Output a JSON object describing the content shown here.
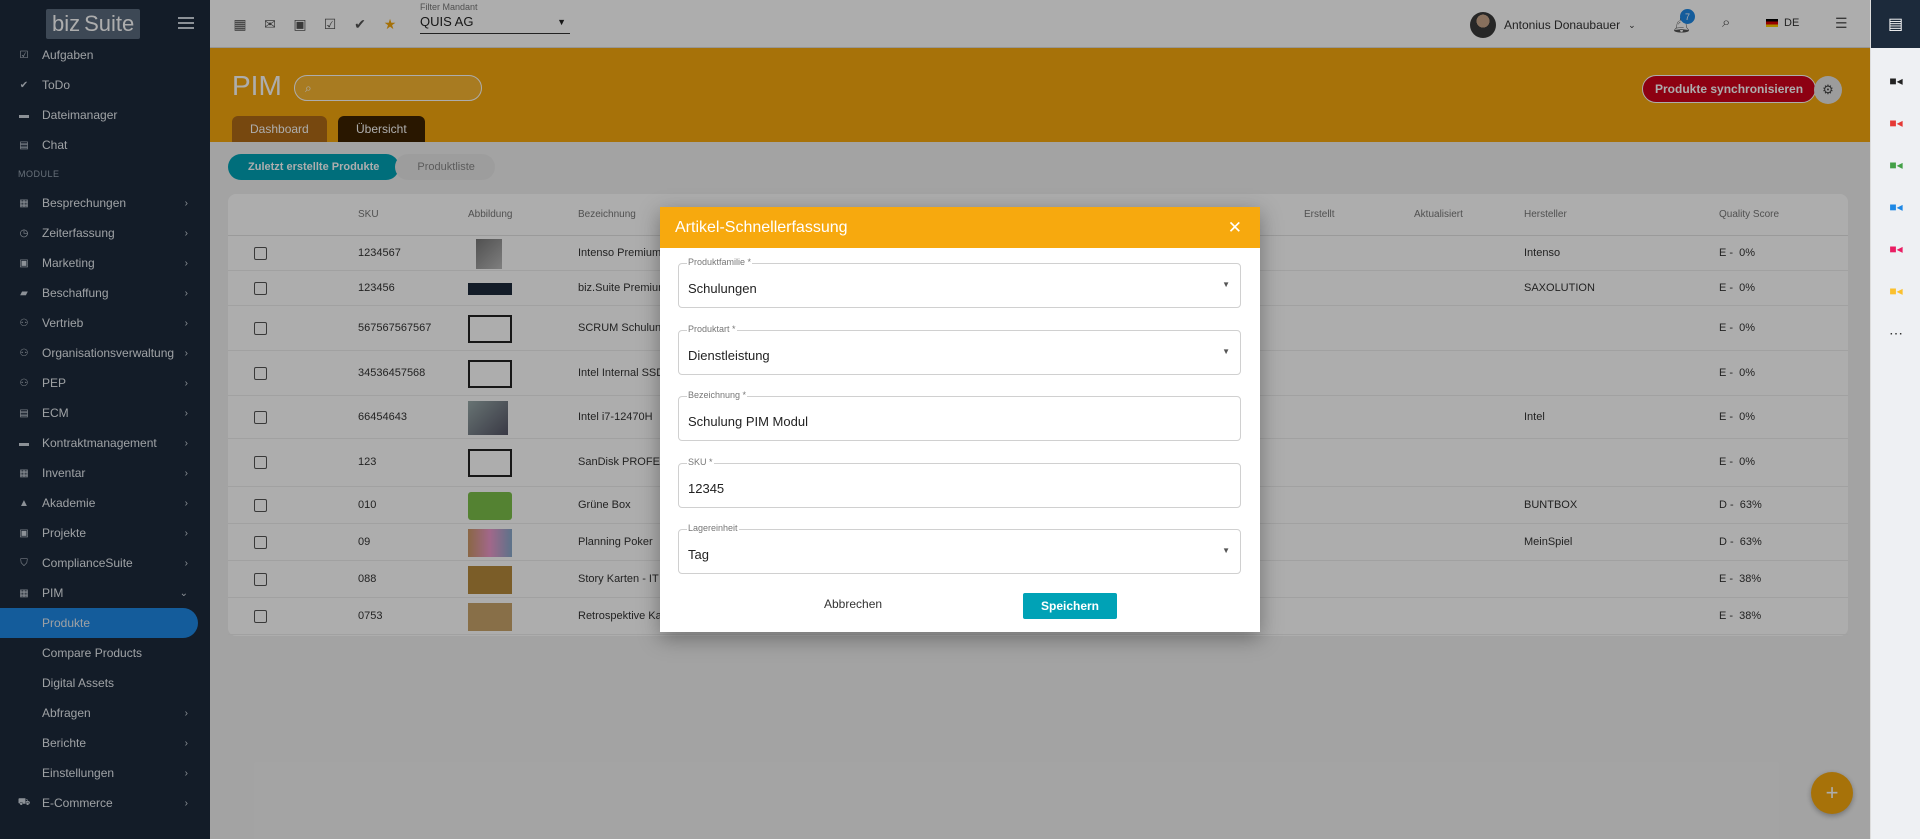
{
  "app": {
    "logo_biz": "biz",
    "logo_suite": "Suite"
  },
  "sidebar": {
    "top_items": [
      {
        "label": "Aufgaben",
        "icon": "task-icon"
      },
      {
        "label": "ToDo",
        "icon": "check-icon"
      },
      {
        "label": "Dateimanager",
        "icon": "folder-icon"
      },
      {
        "label": "Chat",
        "icon": "chat-icon"
      }
    ],
    "section_label": "MODULE",
    "modules": [
      {
        "label": "Besprechungen",
        "icon": "meeting-icon"
      },
      {
        "label": "Zeiterfassung",
        "icon": "clock-icon"
      },
      {
        "label": "Marketing",
        "icon": "marketing-icon"
      },
      {
        "label": "Beschaffung",
        "icon": "truck-icon"
      },
      {
        "label": "Vertrieb",
        "icon": "people-icon"
      },
      {
        "label": "Organisationsverwaltung",
        "icon": "org-icon"
      },
      {
        "label": "PEP",
        "icon": "people-icon"
      },
      {
        "label": "ECM",
        "icon": "document-icon"
      },
      {
        "label": "Kontraktmanagement",
        "icon": "briefcase-icon"
      },
      {
        "label": "Inventar",
        "icon": "inventory-icon"
      },
      {
        "label": "Akademie",
        "icon": "school-icon"
      },
      {
        "label": "Projekte",
        "icon": "project-icon"
      },
      {
        "label": "ComplianceSuite",
        "icon": "shield-icon"
      },
      {
        "label": "PIM",
        "icon": "pim-icon"
      }
    ],
    "pim_sub": [
      {
        "label": "Produkte",
        "active": true,
        "has_children": false
      },
      {
        "label": "Compare Products",
        "active": false,
        "has_children": false
      },
      {
        "label": "Digital Assets",
        "active": false,
        "has_children": false
      },
      {
        "label": "Abfragen",
        "active": false,
        "has_children": true
      },
      {
        "label": "Berichte",
        "active": false,
        "has_children": true
      },
      {
        "label": "Einstellungen",
        "active": false,
        "has_children": true
      }
    ],
    "bottom_item": {
      "label": "E-Commerce",
      "icon": "cart-icon"
    }
  },
  "topbar": {
    "mandant_label": "Filter Mandant",
    "mandant_value": "QUIS AG",
    "user_name": "Antonius Donaubauer",
    "notification_count": "7",
    "language": "DE"
  },
  "pim": {
    "title": "PIM",
    "search_placeholder": "",
    "tabs": [
      "Dashboard",
      "Übersicht"
    ],
    "sync_button": "Produkte synchronisieren",
    "subtabs": [
      "Zuletzt erstellte Produkte",
      "Produktliste"
    ]
  },
  "table": {
    "columns": [
      "SKU",
      "Abbildung",
      "Bezeichnung",
      "Erstellt",
      "Aktualisiert",
      "Hersteller",
      "Quality Score"
    ],
    "rows": [
      {
        "sku": "1234567",
        "name": "Intenso Premium",
        "thumb": "usb",
        "maker": "Intenso",
        "score": "E -  0%"
      },
      {
        "sku": "123456",
        "name": "biz.Suite Premium",
        "thumb": "bizsuite",
        "maker": "SAXOLUTION",
        "score": "E -  0%"
      },
      {
        "sku": "567567567567",
        "name": "SCRUM Schulung",
        "thumb": "placeholder",
        "maker": "",
        "score": "E -  0%"
      },
      {
        "sku": "34536457568",
        "name": "Intel Internal SSD",
        "thumb": "placeholder",
        "maker": "",
        "score": "E -  0%"
      },
      {
        "sku": "66454643",
        "name": "Intel i7-12470H",
        "thumb": "cpu",
        "maker": "Intel",
        "score": "E -  0%"
      },
      {
        "sku": "123",
        "name": "SanDisk PROFES",
        "thumb": "placeholder",
        "maker": "",
        "score": "E -  0%"
      },
      {
        "sku": "010",
        "name": "Grüne Box",
        "thumb": "greenbox",
        "maker": "BUNTBOX",
        "score": "D -  63%"
      },
      {
        "sku": "09",
        "name": "Planning Poker",
        "thumb": "cards",
        "maker": "MeinSpiel",
        "score": "D -  63%"
      },
      {
        "sku": "088",
        "name": "Story Karten - IT",
        "thumb": "storycards",
        "maker": "",
        "score": "E -  38%"
      },
      {
        "sku": "0753",
        "name": "Retrospektive Ka",
        "thumb": "retro",
        "maker": "",
        "score": "E -  38%"
      }
    ]
  },
  "dialog": {
    "title": "Artikel-Schnellerfassung",
    "fields": [
      {
        "label": "Produktfamilie *",
        "value": "Schulungen",
        "dropdown": true
      },
      {
        "label": "Produktart *",
        "value": "Dienstleistung",
        "dropdown": true
      },
      {
        "label": "Bezeichnung *",
        "value": "Schulung PIM Modul",
        "dropdown": false
      },
      {
        "label": "SKU *",
        "value": "12345",
        "dropdown": false
      },
      {
        "label": "Lagereinheit",
        "value": "Tag",
        "dropdown": true
      }
    ],
    "cancel_label": "Abbrechen",
    "save_label": "Speichern"
  },
  "colors": {
    "accent_orange": "#f7a90e",
    "teal": "#00a2b6",
    "sync_red": "#d0021b",
    "sidebar_bg": "#1c2a3b",
    "active_blue": "#1e88e5"
  }
}
